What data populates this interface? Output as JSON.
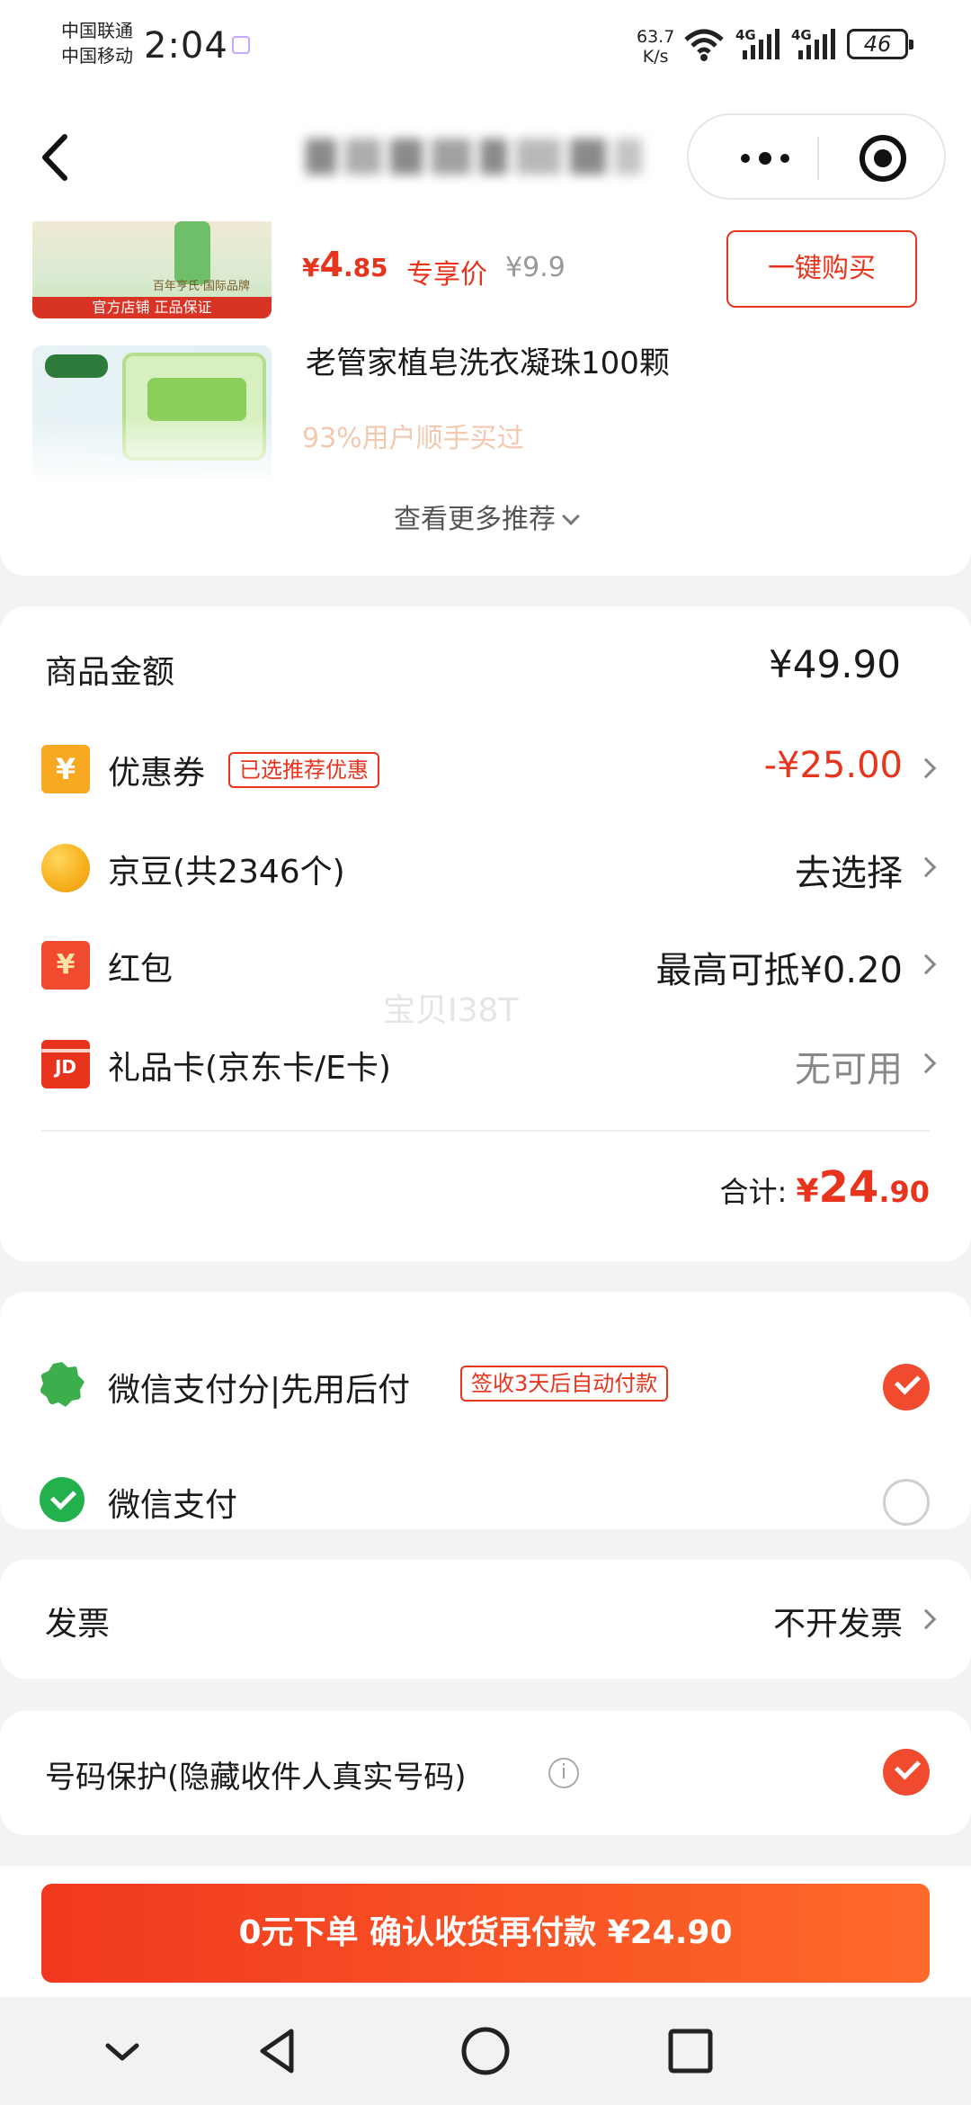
{
  "status_bar": {
    "carrier_1": "中国联通",
    "carrier_2": "中国移动",
    "time": "2:04",
    "speed_value": "63.7",
    "speed_unit": "K/s",
    "signal_1": "4G",
    "signal_2": "4G",
    "battery": "46"
  },
  "nav": {
    "title_hidden": true,
    "icons": [
      "back-icon",
      "more-icon",
      "close-icon"
    ]
  },
  "recommendations": {
    "item1": {
      "price_symbol": "¥",
      "price_main": "4",
      "price_decimal": ".85",
      "exclusive_label": "专享价",
      "original_price": "¥9.9",
      "buy_button": "一键购买",
      "image_strip": "官方店铺 正品保证",
      "image_sub": "百年亨氏·国际品牌"
    },
    "item2": {
      "name": "老管家植皂洗衣凝珠100颗",
      "sales_text": "93%用户顺手买过"
    },
    "see_more": "查看更多推荐"
  },
  "price": {
    "goods_amount_label": "商品金额",
    "goods_amount_value": "¥49.90",
    "rows": [
      {
        "label": "优惠券",
        "tag": "已选推荐优惠",
        "value": "-¥25.00",
        "icon": "coupon-icon",
        "icon_text": "¥"
      },
      {
        "label": "京豆(共2346个)",
        "value": "去选择",
        "icon": "jd-bean-icon"
      },
      {
        "label": "红包",
        "value": "最高可抵¥0.20",
        "icon": "red-packet-icon",
        "icon_text": "¥"
      },
      {
        "label": "礼品卡(京东卡/E卡)",
        "value": "无可用",
        "icon": "gift-card-icon",
        "icon_text": "JD"
      }
    ],
    "watermark": "宝贝I38T",
    "total_label": "合计:",
    "total_symbol": "¥",
    "total_main": "24",
    "total_cents": ".90"
  },
  "payment": {
    "options": [
      {
        "label": "微信支付分|先用后付",
        "tag": "签收3天后自动付款",
        "selected": true,
        "icon": "wechat-pay-score-icon"
      },
      {
        "label": "微信支付",
        "selected": false,
        "icon": "wechat-pay-icon"
      }
    ]
  },
  "invoice": {
    "label": "发票",
    "value": "不开发票"
  },
  "privacy": {
    "label": "号码保护(隐藏收件人真实号码)",
    "info": "i",
    "checked": true
  },
  "submit": {
    "label": "0元下单 确认收货再付款 ¥24.90"
  },
  "colors": {
    "accent": "#e8341d",
    "button_gradient_start": "#f1381f",
    "button_gradient_end": "#fe6a2a",
    "wechat_green": "#22b14c",
    "coupon_orange": "#f6a921"
  }
}
